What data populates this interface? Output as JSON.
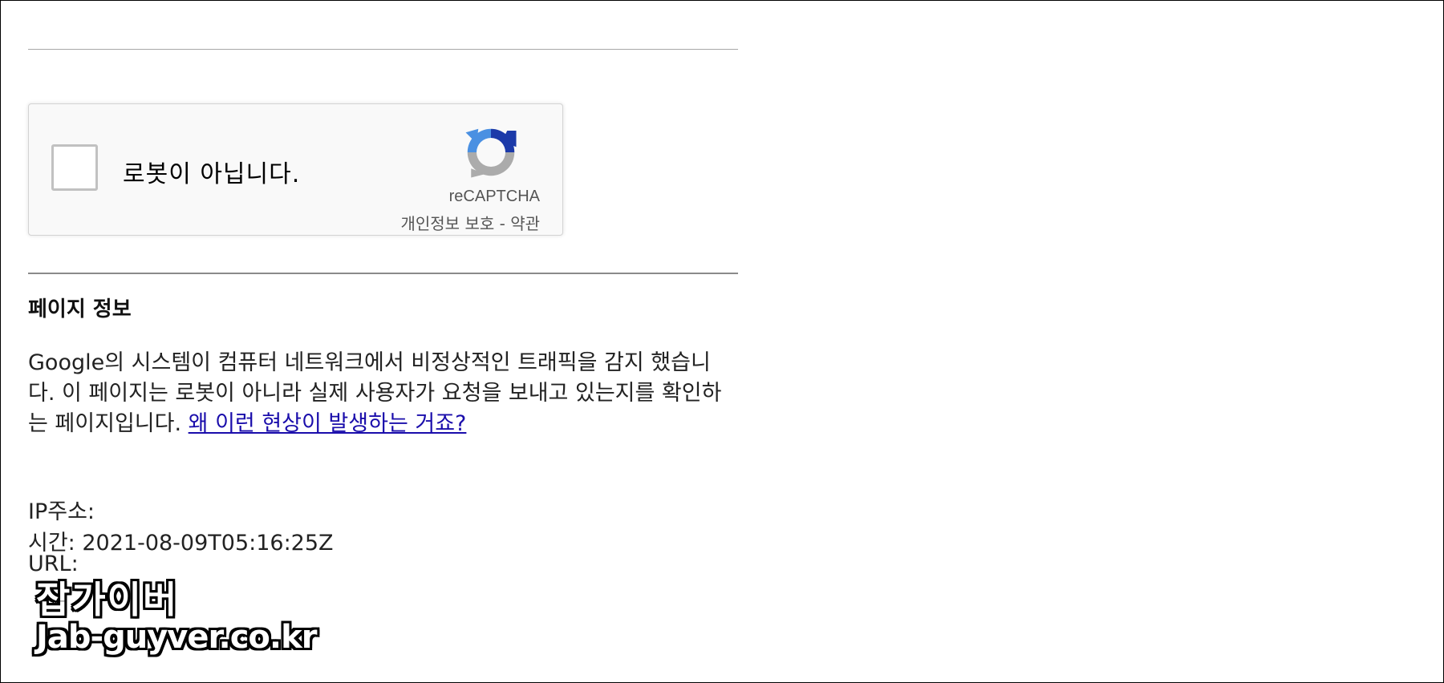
{
  "recaptcha": {
    "checkbox_label": "로봇이 아닙니다.",
    "brand": "reCAPTCHA",
    "privacy_link": "개인정보 보호",
    "separator": "-",
    "terms_link": "약관",
    "icon": "recaptcha-logo-icon"
  },
  "page_info": {
    "heading": "페이지 정보",
    "body": "Google의 시스템이 컴퓨터 네트워크에서 비정상적인 트래픽을 감지 했습니다. 이 페이지는 로봇이 아니라 실제 사용자가 요청을 보내고 있는지를 확인하는 페이지입니다.",
    "why_link": "왜 이런 현상이 발생하는 거죠?"
  },
  "meta": {
    "ip_label": "IP주소:",
    "time_label": "시간:",
    "time_value": "2021-08-09T05:16:25Z",
    "url_label": "URL:"
  },
  "watermark": {
    "name": "잡가이버",
    "url": "Jab-guyver.co.kr"
  },
  "colors": {
    "link": "#1a0dab",
    "recaptcha_blue_dark": "#1c3aa9",
    "recaptcha_blue": "#4a90e2",
    "recaptcha_gray": "#ababab"
  }
}
